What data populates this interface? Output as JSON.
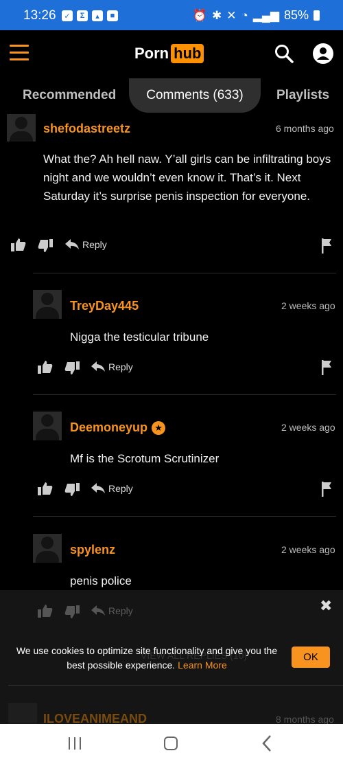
{
  "status_bar": {
    "time": "13:26",
    "left_icons": [
      "check-icon",
      "sigma-icon",
      "gallery-icon",
      "bag-icon"
    ],
    "battery": "85%"
  },
  "header": {
    "logo_part1": "Porn",
    "logo_part2": "hub",
    "accent_color": "#f7931e"
  },
  "tabs": [
    {
      "label": "Recommended",
      "active": false
    },
    {
      "label": "Comments (633)",
      "active": true
    },
    {
      "label": "Playlists",
      "active": false
    }
  ],
  "actions": {
    "reply_label": "Reply"
  },
  "comments": [
    {
      "user": "shefodastreetz",
      "time": "6 months ago",
      "text": "What the? Ah hell naw. Y’all girls can be infiltrating boys night and we wouldn’t even know it. That’s it. Next Saturday it’s surprise penis inspection for everyone."
    },
    {
      "user": "TreyDay445",
      "time": "2 weeks ago",
      "text": "Nigga the testicular tribune"
    },
    {
      "user": "Deemoneyup",
      "time": "2 weeks ago",
      "text": "Mf is the Scrotum Scrutinizer",
      "verified": true
    },
    {
      "user": "spylenz",
      "time": "2 weeks ago",
      "text": "penis police"
    }
  ],
  "hidden_behind_banner": {
    "view_replies": "VIEW ALL REPLIES (10)",
    "next_user": "ILOVEANIMEAND",
    "next_time": "8 months ago"
  },
  "cookie_banner": {
    "text": "We use cookies to optimize site functionality and give you the best possible experience.",
    "link": "Learn More",
    "ok": "OK"
  }
}
